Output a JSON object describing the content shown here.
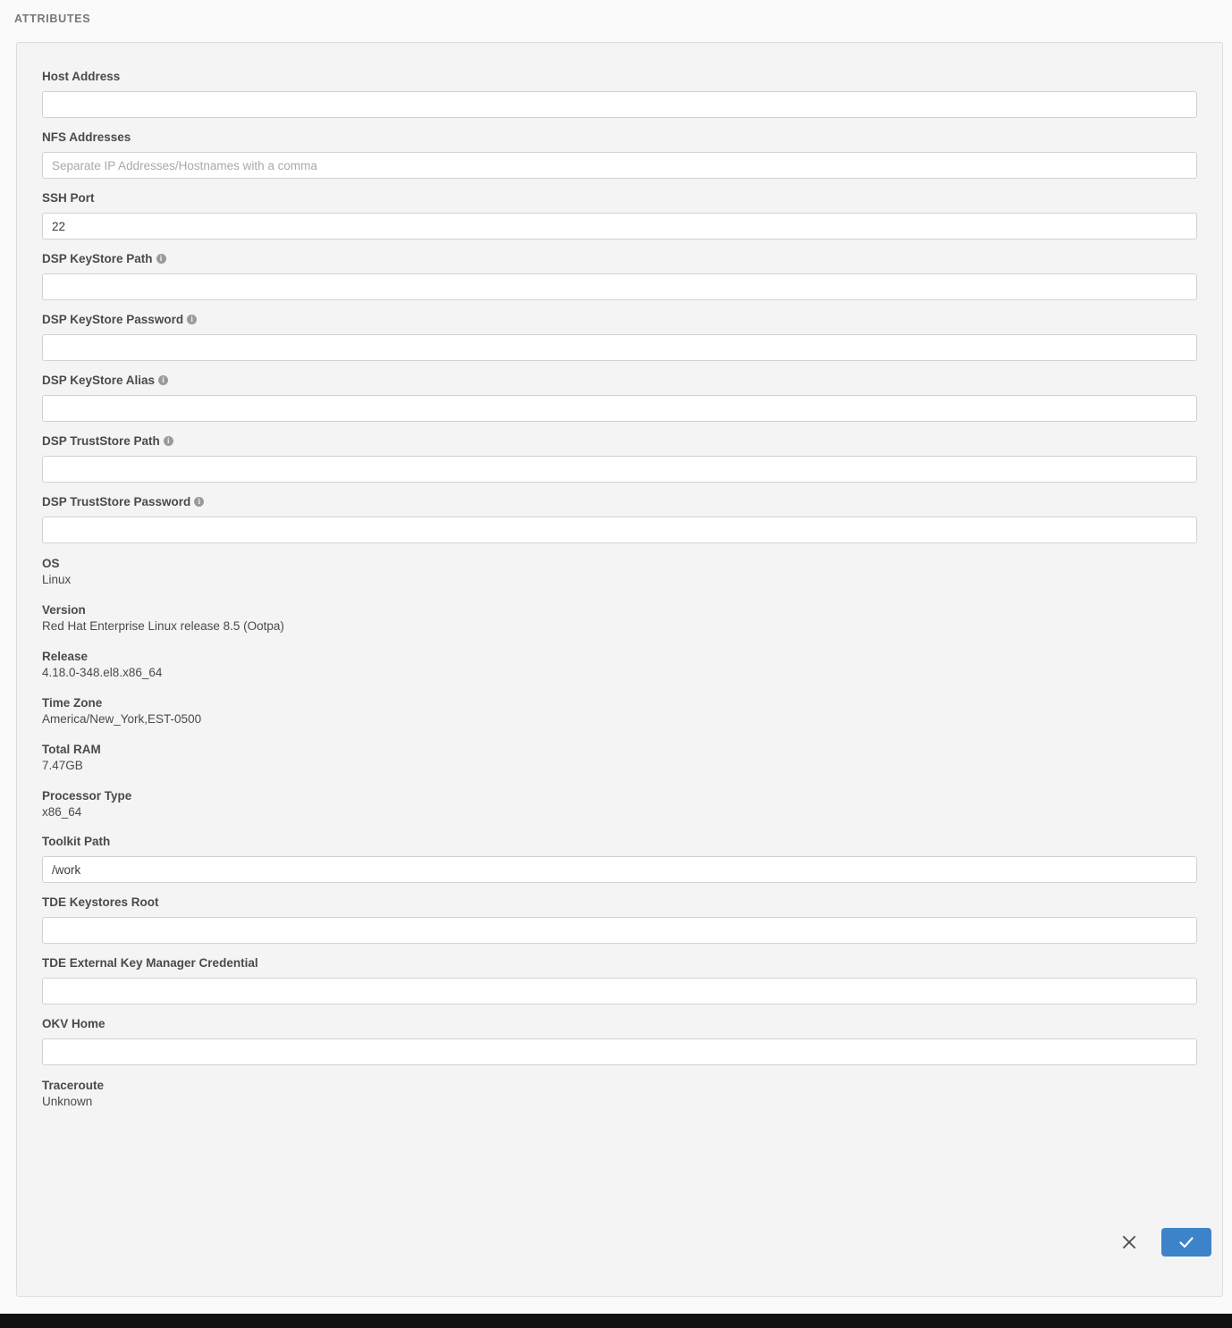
{
  "section": {
    "title": "ATTRIBUTES"
  },
  "colors": {
    "accent": "#3d83c9",
    "card_bg": "#f4f4f4",
    "page_bg": "#fafafa",
    "input_border": "#cfd2d8"
  },
  "fields": [
    {
      "label": "Host Address",
      "value": "",
      "placeholder": "",
      "info": false,
      "type": "input"
    },
    {
      "label": "NFS Addresses",
      "value": "",
      "placeholder": "Separate IP Addresses/Hostnames with a comma",
      "info": false,
      "type": "input"
    },
    {
      "label": "SSH Port",
      "value": "22",
      "placeholder": "",
      "info": false,
      "type": "input"
    },
    {
      "label": "DSP KeyStore Path",
      "value": "",
      "placeholder": "",
      "info": true,
      "type": "input"
    },
    {
      "label": "DSP KeyStore Password",
      "value": "",
      "placeholder": "",
      "info": true,
      "type": "input"
    },
    {
      "label": "DSP KeyStore Alias",
      "value": "",
      "placeholder": "",
      "info": true,
      "type": "input"
    },
    {
      "label": "DSP TrustStore Path",
      "value": "",
      "placeholder": "",
      "info": true,
      "type": "input"
    },
    {
      "label": "DSP TrustStore Password",
      "value": "",
      "placeholder": "",
      "info": true,
      "type": "input"
    },
    {
      "label": "OS",
      "value": "Linux",
      "type": "readonly"
    },
    {
      "label": "Version",
      "value": "Red Hat Enterprise Linux release 8.5 (Ootpa)",
      "type": "readonly"
    },
    {
      "label": "Release",
      "value": "4.18.0-348.el8.x86_64",
      "type": "readonly"
    },
    {
      "label": "Time Zone",
      "value": "America/New_York,EST-0500",
      "type": "readonly"
    },
    {
      "label": "Total RAM",
      "value": "7.47GB",
      "type": "readonly"
    },
    {
      "label": "Processor Type",
      "value": "x86_64",
      "type": "readonly"
    },
    {
      "label": "Toolkit Path",
      "value": "/work",
      "placeholder": "",
      "info": false,
      "type": "input"
    },
    {
      "label": "TDE Keystores Root",
      "value": "",
      "placeholder": "",
      "info": false,
      "type": "input"
    },
    {
      "label": "TDE External Key Manager Credential",
      "value": "",
      "placeholder": "",
      "info": false,
      "type": "input"
    },
    {
      "label": "OKV Home",
      "value": "",
      "placeholder": "",
      "info": false,
      "type": "input"
    },
    {
      "label": "Traceroute",
      "value": "Unknown",
      "type": "readonly"
    }
  ],
  "actions": {
    "cancel": {
      "icon": "close-icon",
      "label": "Cancel"
    },
    "confirm": {
      "icon": "check-icon",
      "label": "Confirm"
    }
  }
}
